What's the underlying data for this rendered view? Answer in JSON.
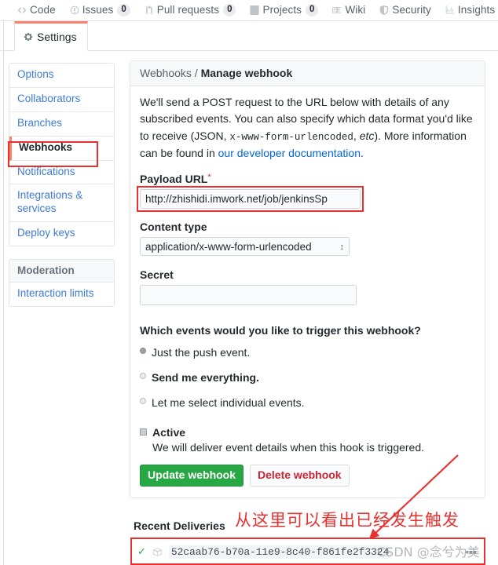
{
  "repo_nav": {
    "items": [
      {
        "label": "Code",
        "icon": "code-icon",
        "count": null
      },
      {
        "label": "Issues",
        "icon": "issue-opened-icon",
        "count": "0"
      },
      {
        "label": "Pull requests",
        "icon": "git-pull-request-icon",
        "count": "0"
      },
      {
        "label": "Projects",
        "icon": "project-icon",
        "count": "0"
      },
      {
        "label": "Wiki",
        "icon": "book-icon",
        "count": null
      },
      {
        "label": "Security",
        "icon": "shield-icon",
        "count": null
      },
      {
        "label": "Insights",
        "icon": "graph-icon",
        "count": null
      }
    ]
  },
  "tab": {
    "settings_label": "Settings",
    "settings_icon": "gear-icon"
  },
  "sidebar": {
    "items": [
      {
        "label": "Options",
        "active": false
      },
      {
        "label": "Collaborators",
        "active": false
      },
      {
        "label": "Branches",
        "active": false
      },
      {
        "label": "Webhooks",
        "active": true
      },
      {
        "label": "Notifications",
        "active": false
      },
      {
        "label": "Integrations & services",
        "active": false
      },
      {
        "label": "Deploy keys",
        "active": false
      }
    ],
    "moderation_heading": "Moderation",
    "moderation_items": [
      {
        "label": "Interaction limits",
        "active": false
      }
    ]
  },
  "panel": {
    "breadcrumb_parent": "Webhooks",
    "breadcrumb_sep": "/",
    "breadcrumb_current": "Manage webhook",
    "lead_part1": "We'll send a POST request to the URL below with details of any subscribed events. You can also specify which data format you'd like to receive (JSON, ",
    "lead_code": "x-www-form-urlencoded",
    "lead_part2": ", ",
    "lead_em": "etc",
    "lead_part3": "). More information can be found in ",
    "lead_link": "our developer documentation",
    "lead_part4": "."
  },
  "form": {
    "payload_url_label": "Payload URL",
    "payload_url_required": "*",
    "payload_url_value": "http://zhishidi.imwork.net/job/jenkinsSp",
    "content_type_label": "Content type",
    "content_type_value": "application/x-www-form-urlencoded",
    "content_type_arrows": "↕",
    "secret_label": "Secret",
    "secret_value": "",
    "events_question": "Which events would you like to trigger this webhook?",
    "event_options": [
      {
        "label": "Just the push event.",
        "checked": true,
        "bold": false
      },
      {
        "label": "Send me everything.",
        "checked": false,
        "bold": true
      },
      {
        "label": "Let me select individual events.",
        "checked": false,
        "bold": false
      }
    ],
    "active_label": "Active",
    "active_checked": true,
    "active_description": "We will deliver event details when this hook is triggered.",
    "update_button": "Update webhook",
    "delete_button": "Delete webhook"
  },
  "deliveries": {
    "title": "Recent Deliveries",
    "rows": [
      {
        "status_icon": "check-icon",
        "package_icon": "package-icon",
        "id": "52caab76-b70a-11e9-8c40-f861fe2f3324",
        "overflow": "•••"
      }
    ]
  },
  "annotations": {
    "note_text": "从这里可以看出已经发生触发",
    "note_color": "#ea2f2f",
    "watermark": "CSDN @念兮为美"
  },
  "colors": {
    "accent_orange": "#f9826c",
    "link_blue": "#0366d6",
    "sidebar_link": "#3d7bd6",
    "green_button": "#28a745",
    "danger_red": "#cb2431",
    "annotation_red": "#ea2f2f",
    "border": "#e1e4e8"
  }
}
